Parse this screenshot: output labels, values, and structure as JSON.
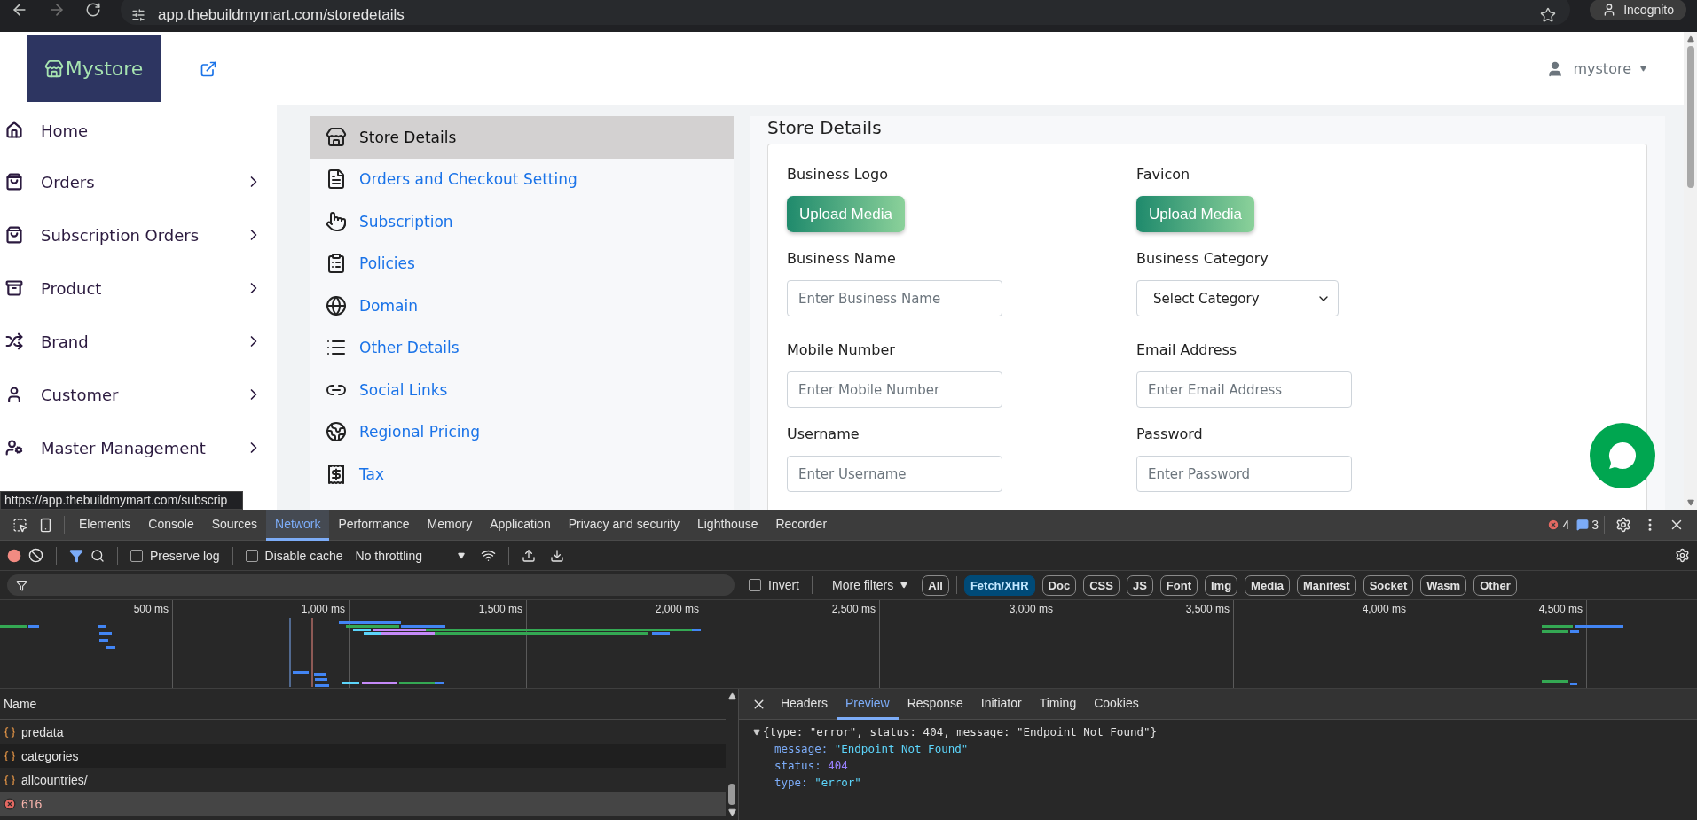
{
  "browser": {
    "url": "app.thebuildmymart.com/storedetails",
    "profile": "Incognito"
  },
  "store": {
    "logo": "Mystore",
    "user": "mystore"
  },
  "sidebar": {
    "items": [
      {
        "label": "Home",
        "chevron": false
      },
      {
        "label": "Orders",
        "chevron": true
      },
      {
        "label": "Subscription Orders",
        "chevron": true
      },
      {
        "label": "Product",
        "chevron": true
      },
      {
        "label": "Brand",
        "chevron": true
      },
      {
        "label": "Customer",
        "chevron": true
      },
      {
        "label": "Master Management",
        "chevron": true
      }
    ]
  },
  "status_link": "https://app.thebuildmymart.com/subscrip",
  "settings_menu": {
    "items": [
      {
        "label": "Store Details",
        "selected": true
      },
      {
        "label": "Orders and Checkout Setting",
        "selected": false
      },
      {
        "label": "Subscription",
        "selected": false
      },
      {
        "label": "Policies",
        "selected": false
      },
      {
        "label": "Domain",
        "selected": false
      },
      {
        "label": "Other Details",
        "selected": false
      },
      {
        "label": "Social Links",
        "selected": false
      },
      {
        "label": "Regional Pricing",
        "selected": false
      },
      {
        "label": "Tax",
        "selected": false
      }
    ]
  },
  "panel": {
    "title": "Store Details",
    "fields": [
      {
        "kind": "upload",
        "label": "Business Logo",
        "button": "Upload Media"
      },
      {
        "kind": "upload",
        "label": "Favicon",
        "button": "Upload Media"
      },
      {
        "kind": "input",
        "label": "Business Name",
        "placeholder": "Enter Business Name"
      },
      {
        "kind": "select",
        "label": "Business Category",
        "value": "Select Category"
      },
      {
        "kind": "input",
        "label": "Mobile Number",
        "placeholder": "Enter Mobile Number"
      },
      {
        "kind": "input",
        "label": "Email Address",
        "placeholder": "Enter Email Address"
      },
      {
        "kind": "input",
        "label": "Username",
        "placeholder": "Enter Username"
      },
      {
        "kind": "input",
        "label": "Password",
        "placeholder": "Enter Password"
      }
    ]
  },
  "devtools": {
    "tabs": [
      {
        "label": "Elements",
        "selected": false
      },
      {
        "label": "Console",
        "selected": false
      },
      {
        "label": "Sources",
        "selected": false
      },
      {
        "label": "Network",
        "selected": true
      },
      {
        "label": "Performance",
        "selected": false
      },
      {
        "label": "Memory",
        "selected": false
      },
      {
        "label": "Application",
        "selected": false
      },
      {
        "label": "Privacy and security",
        "selected": false
      },
      {
        "label": "Lighthouse",
        "selected": false
      },
      {
        "label": "Recorder",
        "selected": false
      }
    ],
    "error_count": "4",
    "message_count": "3",
    "toolbar": {
      "preserve_log": {
        "label": "Preserve log",
        "checked": false
      },
      "disable_cache": {
        "label": "Disable cache",
        "checked": false
      },
      "throttling": "No throttling"
    },
    "filter": {
      "invert": {
        "label": "Invert",
        "checked": false
      },
      "more_filters": "More filters",
      "types": [
        {
          "label": "All",
          "selected": false
        },
        {
          "label": "Fetch/XHR",
          "selected": true
        },
        {
          "label": "Doc",
          "selected": false
        },
        {
          "label": "CSS",
          "selected": false
        },
        {
          "label": "JS",
          "selected": false
        },
        {
          "label": "Font",
          "selected": false
        },
        {
          "label": "Img",
          "selected": false
        },
        {
          "label": "Media",
          "selected": false
        },
        {
          "label": "Manifest",
          "selected": false
        },
        {
          "label": "Socket",
          "selected": false
        },
        {
          "label": "Wasm",
          "selected": false
        },
        {
          "label": "Other",
          "selected": false
        }
      ]
    },
    "timeline_ticks": [
      "500 ms",
      "1,000 ms",
      "1,500 ms",
      "2,000 ms",
      "2,500 ms",
      "3,000 ms",
      "3,500 ms",
      "4,000 ms",
      "4,500 ms"
    ],
    "requests": {
      "header": "Name",
      "rows": [
        {
          "name": "predata",
          "kind": "xhr",
          "selected": false
        },
        {
          "name": "categories",
          "kind": "xhr",
          "selected": false
        },
        {
          "name": "allcountries/",
          "kind": "xhr",
          "selected": false
        },
        {
          "name": "616",
          "kind": "error",
          "selected": true
        }
      ]
    },
    "detail_tabs": [
      {
        "label": "Headers",
        "selected": false
      },
      {
        "label": "Preview",
        "selected": true
      },
      {
        "label": "Response",
        "selected": false
      },
      {
        "label": "Initiator",
        "selected": false
      },
      {
        "label": "Timing",
        "selected": false
      },
      {
        "label": "Cookies",
        "selected": false
      }
    ],
    "preview": {
      "summary": "{type: \"error\", status: 404, message: \"Endpoint Not Found\"}",
      "properties": [
        {
          "key": "message:",
          "value": "\"Endpoint Not Found\"",
          "kind": "string"
        },
        {
          "key": "status:",
          "value": "404",
          "kind": "number"
        },
        {
          "key": "type:",
          "value": "\"error\"",
          "kind": "string"
        }
      ]
    }
  }
}
